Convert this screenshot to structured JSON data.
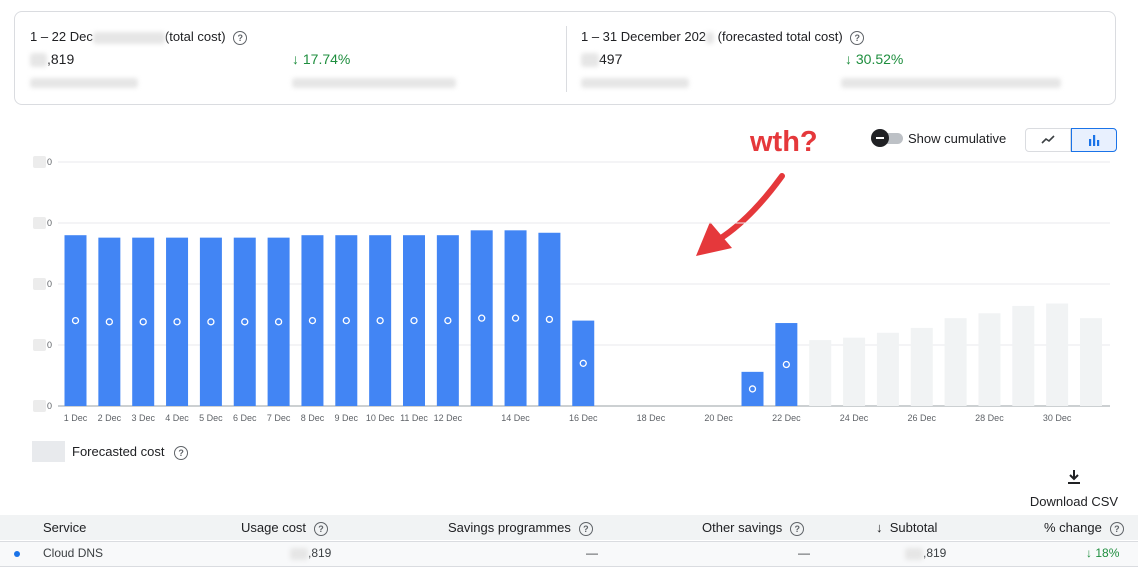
{
  "summary": {
    "left": {
      "title_prefix": "1 – 22 Dec",
      "title_suffix": "(total cost)",
      "value": ",819",
      "change": "17.74%"
    },
    "right": {
      "title_prefix": "1 – 31 December 202",
      "title_suffix": "(forecasted total cost)",
      "value": "497",
      "change": "30.52%"
    }
  },
  "controls": {
    "cumulative_label": "Show cumulative",
    "cumulative_on": false,
    "chart_mode": "bar",
    "icons": [
      "line-chart-icon",
      "bar-chart-icon"
    ]
  },
  "annotation": {
    "text": "wth?",
    "color": "#e5383b"
  },
  "legend": {
    "forecast_label": "Forecasted cost"
  },
  "download": {
    "label": "Download CSV",
    "icon": "download-icon"
  },
  "colors": {
    "actual": "#4285f4",
    "forecast": "#f1f3f4",
    "positive": "#1e8e3e"
  },
  "chart_data": {
    "type": "bar",
    "x_tick_labels": [
      "1 Dec",
      "2 Dec",
      "3 Dec",
      "4 Dec",
      "5 Dec",
      "6 Dec",
      "7 Dec",
      "8 Dec",
      "9 Dec",
      "10 Dec",
      "11 Dec",
      "12 Dec",
      "14 Dec",
      "16 Dec",
      "18 Dec",
      "20 Dec",
      "22 Dec",
      "24 Dec",
      "26 Dec",
      "28 Dec",
      "30 Dec"
    ],
    "days": [
      1,
      2,
      3,
      4,
      5,
      6,
      7,
      8,
      9,
      10,
      11,
      12,
      13,
      14,
      15,
      16,
      17,
      18,
      19,
      20,
      21,
      22,
      23,
      24,
      25,
      26,
      27,
      28,
      29,
      30,
      31
    ],
    "actual": [
      0.7,
      0.69,
      0.69,
      0.69,
      0.69,
      0.69,
      0.69,
      0.7,
      0.7,
      0.7,
      0.7,
      0.7,
      0.72,
      0.72,
      0.71,
      0.35,
      0,
      0,
      0,
      0,
      0.14,
      0.34,
      null,
      null,
      null,
      null,
      null,
      null,
      null,
      null,
      null
    ],
    "forecast": [
      null,
      null,
      null,
      null,
      null,
      null,
      null,
      null,
      null,
      null,
      null,
      null,
      null,
      null,
      null,
      null,
      null,
      null,
      null,
      null,
      null,
      null,
      0.27,
      0.28,
      0.3,
      0.32,
      0.36,
      0.38,
      0.41,
      0.42,
      0.36
    ],
    "ylim": [
      0,
      1
    ],
    "grid": true
  },
  "table": {
    "headers": [
      "Service",
      "Usage cost",
      "Savings programmes",
      "Other savings",
      "Subtotal",
      "% change"
    ],
    "sort_icon": "arrow-down-icon",
    "rows": [
      {
        "service": "Cloud DNS",
        "usage_cost": ",819",
        "savings": "—",
        "other": "—",
        "subtotal": ",819",
        "change": "18%"
      }
    ]
  }
}
